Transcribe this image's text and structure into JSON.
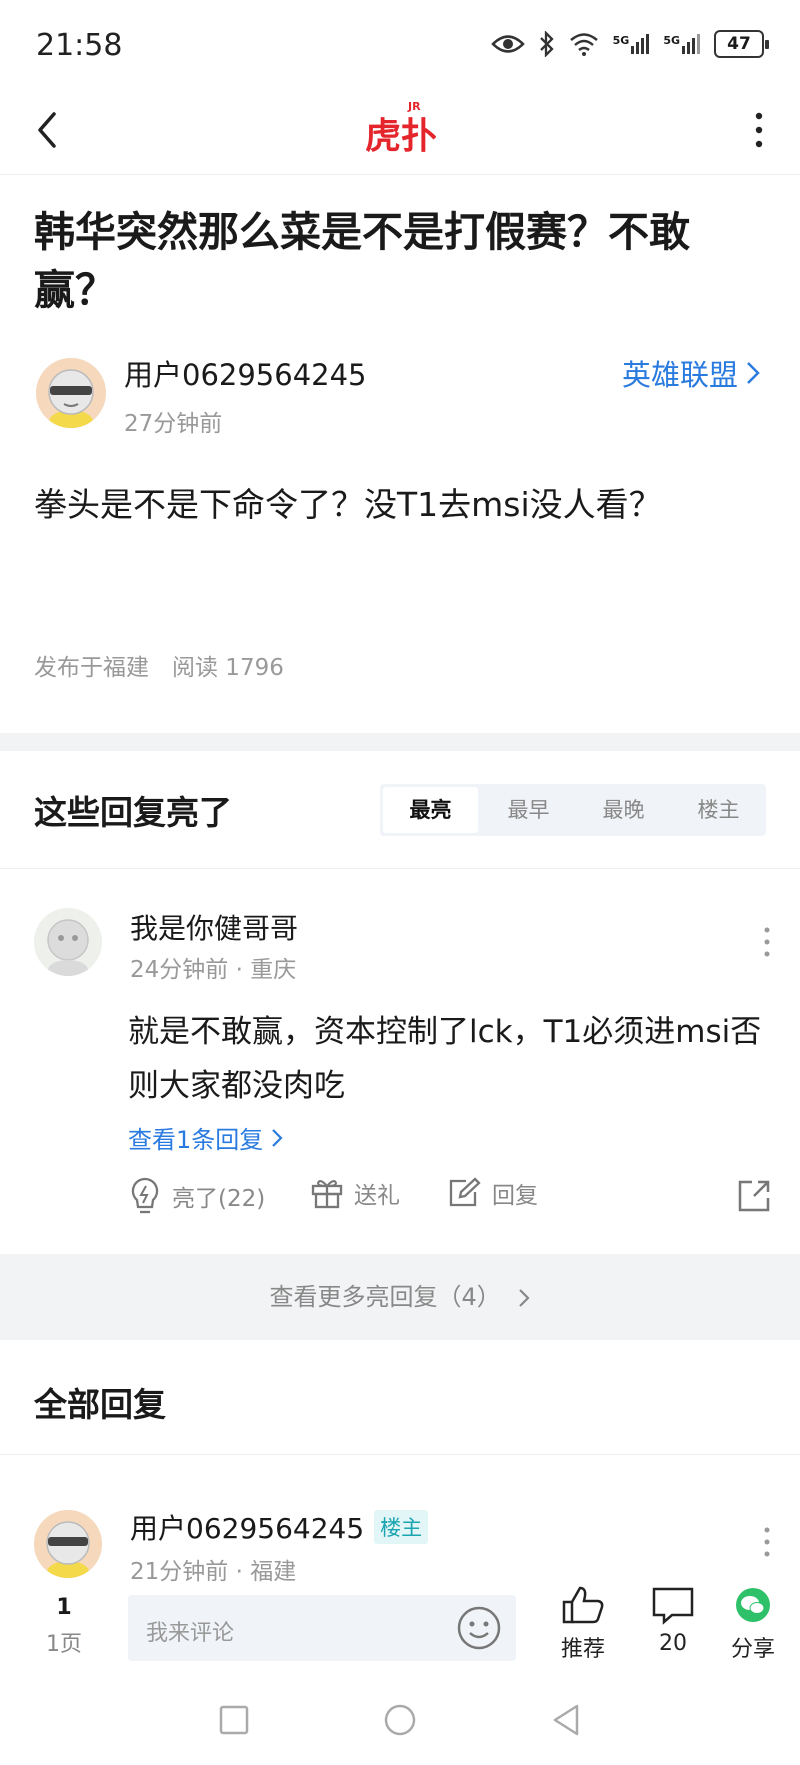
{
  "status_bar": {
    "time": "21:58",
    "signal_1": "5G",
    "signal_2": "5G",
    "battery": "47"
  },
  "nav": {
    "logo_text": "虎扑",
    "logo_tag": "JR"
  },
  "post": {
    "title": "韩华突然那么菜是不是打假赛？不敢赢？",
    "author": "用户0629564245",
    "time": "27分钟前",
    "forum": "英雄联盟",
    "body": "拳头是不是下命令了？没T1去msi没人看？",
    "meta": "发布于福建　阅读 1796"
  },
  "highlight_section": {
    "title": "这些回复亮了",
    "sort_tabs": [
      "最亮",
      "最早",
      "最晚",
      "楼主"
    ]
  },
  "highlight_comment": {
    "author": "我是你健哥哥",
    "meta": "24分钟前 · 重庆",
    "body": "就是不敢赢，资本控制了lck，T1必须进msi否则大家都没肉吃",
    "view_replies": "查看1条回复",
    "like_label": "亮了(22)",
    "gift_label": "送礼",
    "reply_label": "回复"
  },
  "more_highlights": "查看更多亮回复（4）",
  "all_section": {
    "title": "全部回复"
  },
  "first_reply": {
    "author": "用户0629564245",
    "badge": "楼主",
    "meta": "21分钟前 · 福建"
  },
  "bottom_bar": {
    "page_number": "1",
    "page_label": "1页",
    "input_placeholder": "我来评论",
    "recommend_label": "推荐",
    "comment_count": "20",
    "share_label": "分享"
  },
  "colors": {
    "accent_blue": "#2a7be0",
    "logo_red": "#e4252c",
    "wechat_green": "#2ec16a"
  }
}
